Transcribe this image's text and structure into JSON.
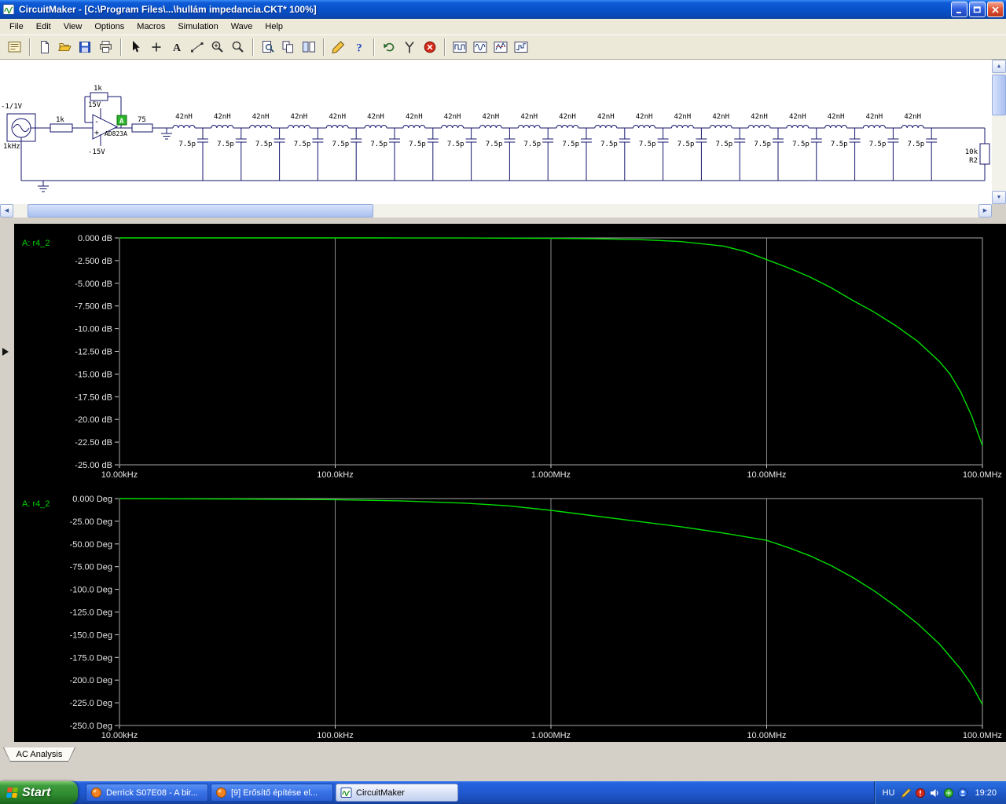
{
  "window": {
    "title": "CircuitMaker - [C:\\Program Files\\...\\hullám impedancia.CKT* 100%]"
  },
  "menu": {
    "items": [
      "File",
      "Edit",
      "View",
      "Options",
      "Macros",
      "Simulation",
      "Wave",
      "Help"
    ]
  },
  "toolbar": {
    "groups": [
      [
        {
          "name": "browse-schematic",
          "icon": "board"
        }
      ],
      [
        {
          "name": "new-file",
          "icon": "new"
        },
        {
          "name": "open-file",
          "icon": "open"
        },
        {
          "name": "save-file",
          "icon": "save"
        },
        {
          "name": "print",
          "icon": "print"
        }
      ],
      [
        {
          "name": "select-tool",
          "icon": "cursor"
        },
        {
          "name": "place-part",
          "icon": "plus"
        },
        {
          "name": "text-tool",
          "icon": "text"
        },
        {
          "name": "wire-tool",
          "icon": "wire"
        },
        {
          "name": "zoom-in-tool",
          "icon": "zoomin"
        },
        {
          "name": "zoom-tool",
          "icon": "zoom"
        }
      ],
      [
        {
          "name": "preview",
          "icon": "preview"
        },
        {
          "name": "copy",
          "icon": "copy"
        },
        {
          "name": "tile-windows",
          "icon": "tile"
        }
      ],
      [
        {
          "name": "edit-simulation",
          "icon": "tool"
        },
        {
          "name": "help",
          "icon": "help"
        }
      ],
      [
        {
          "name": "reset-simulation",
          "icon": "undo"
        },
        {
          "name": "probe-tool",
          "icon": "probe"
        },
        {
          "name": "stop-simulation",
          "icon": "stop"
        }
      ],
      [
        {
          "name": "waveform-digital",
          "icon": "wave-a"
        },
        {
          "name": "waveform-analog",
          "icon": "wave-b"
        },
        {
          "name": "waveform-mixed",
          "icon": "wave-c"
        },
        {
          "name": "waveform-step",
          "icon": "wave-d"
        }
      ]
    ]
  },
  "schematic": {
    "source": {
      "amplitude_label": "-1/1V",
      "freq_label": "1kHz"
    },
    "input_resistor": "1k",
    "opamp": {
      "part": "AD823A",
      "vplus": "15V",
      "vminus": "-15V",
      "feedback_resistor": "1k",
      "probe_label": "A"
    },
    "series_resistor": "75",
    "ladder": {
      "stages": 20,
      "inductor_label": "42nH",
      "capacitor_label": "7.5p"
    },
    "termination": {
      "value": "10k",
      "ref": "R2"
    }
  },
  "tab": {
    "label": "AC Analysis"
  },
  "taskbar": {
    "start": "Start",
    "tasks": [
      {
        "label": "Derrick S07E08 - A bir...",
        "icon": "media-orange",
        "active": false
      },
      {
        "label": "[9] Erősítő építése el...",
        "icon": "media-orange",
        "active": false
      },
      {
        "label": "CircuitMaker",
        "icon": "circuitmaker",
        "active": true
      }
    ],
    "tray": {
      "lang": "HU",
      "icons": [
        "pencil",
        "alert",
        "volume",
        "network",
        "messenger"
      ],
      "time": "19:20"
    }
  },
  "chart_data": [
    {
      "type": "line",
      "title": "A: r4_2",
      "x_scale": "log",
      "x_ticks": [
        "10.00kHz",
        "100.0kHz",
        "1.000MHz",
        "10.00MHz",
        "100.0MHz"
      ],
      "y_ticks": [
        "0.000 dB",
        "-2.500 dB",
        "-5.000 dB",
        "-7.500 dB",
        "-10.00 dB",
        "-12.50 dB",
        "-15.00 dB",
        "-17.50 dB",
        "-20.00 dB",
        "-22.50 dB",
        "-25.00 dB"
      ],
      "ylabel_unit": "dB",
      "ylim": [
        -25,
        0
      ],
      "xlim_decades": [
        0,
        4
      ],
      "grid": "vertical-decades",
      "legend": "none",
      "series": [
        {
          "name": "r4_2",
          "color": "#00dd00",
          "points": [
            [
              0,
              0
            ],
            [
              0.6,
              0
            ],
            [
              1.2,
              0
            ],
            [
              1.6,
              -0.01
            ],
            [
              2.0,
              -0.04
            ],
            [
              2.2,
              -0.09
            ],
            [
              2.4,
              -0.18
            ],
            [
              2.6,
              -0.4
            ],
            [
              2.8,
              -0.9
            ],
            [
              2.9,
              -1.5
            ],
            [
              3.0,
              -2.4
            ],
            [
              3.1,
              -3.3
            ],
            [
              3.2,
              -4.3
            ],
            [
              3.3,
              -5.5
            ],
            [
              3.4,
              -6.9
            ],
            [
              3.5,
              -8.2
            ],
            [
              3.6,
              -9.7
            ],
            [
              3.7,
              -11.4
            ],
            [
              3.8,
              -13.6
            ],
            [
              3.85,
              -15.0
            ],
            [
              3.9,
              -17.0
            ],
            [
              3.95,
              -19.6
            ],
            [
              4.0,
              -22.9
            ]
          ]
        }
      ]
    },
    {
      "type": "line",
      "title": "A: r4_2",
      "x_scale": "log",
      "x_ticks": [
        "10.00kHz",
        "100.0kHz",
        "1.000MHz",
        "10.00MHz",
        "100.0MHz"
      ],
      "y_ticks": [
        "0.000 Deg",
        "-25.00 Deg",
        "-50.00 Deg",
        "-75.00 Deg",
        "-100.0 Deg",
        "-125.0 Deg",
        "-150.0 Deg",
        "-175.0 Deg",
        "-200.0 Deg",
        "-225.0 Deg",
        "-250.0 Deg"
      ],
      "ylabel_unit": "Deg",
      "ylim": [
        -250,
        0
      ],
      "xlim_decades": [
        0,
        4
      ],
      "grid": "vertical-decades",
      "legend": "none",
      "series": [
        {
          "name": "r4_2",
          "color": "#00dd00",
          "points": [
            [
              0,
              0
            ],
            [
              0.5,
              -0.4
            ],
            [
              1.0,
              -1.2
            ],
            [
              1.3,
              -2.5
            ],
            [
              1.6,
              -5
            ],
            [
              1.8,
              -8
            ],
            [
              2.0,
              -13
            ],
            [
              2.2,
              -19
            ],
            [
              2.4,
              -25
            ],
            [
              2.6,
              -31
            ],
            [
              2.8,
              -38
            ],
            [
              3.0,
              -46
            ],
            [
              3.1,
              -54
            ],
            [
              3.2,
              -63
            ],
            [
              3.3,
              -74
            ],
            [
              3.4,
              -87
            ],
            [
              3.5,
              -102
            ],
            [
              3.6,
              -119
            ],
            [
              3.7,
              -138
            ],
            [
              3.8,
              -160
            ],
            [
              3.9,
              -188
            ],
            [
              3.95,
              -205
            ],
            [
              4.0,
              -227
            ]
          ]
        }
      ]
    }
  ]
}
